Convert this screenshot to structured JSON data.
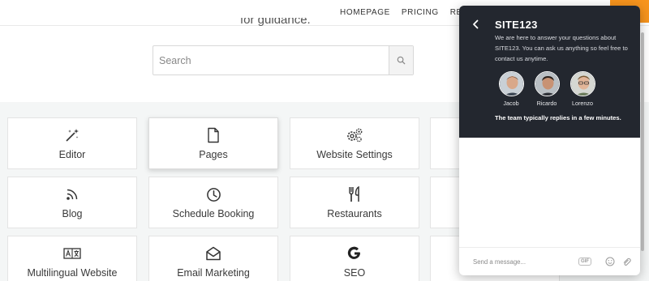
{
  "nav": {
    "links": [
      "HOMEPAGE",
      "PRICING",
      "REVIEWS"
    ],
    "cta_color": "#f7941d"
  },
  "headline": "for guidance.",
  "search": {
    "placeholder": "Search",
    "button_icon": "search-icon"
  },
  "cards": [
    {
      "label": "Editor",
      "icon": "magic-wand-icon"
    },
    {
      "label": "Pages",
      "icon": "page-icon",
      "active": true
    },
    {
      "label": "Website Settings",
      "icon": "gears-icon"
    },
    {
      "label": "Blog",
      "icon": "rss-icon"
    },
    {
      "label": "Schedule Booking",
      "icon": "clock-icon"
    },
    {
      "label": "Restaurants",
      "icon": "fork-knife-icon"
    },
    {
      "label": "Multilingual Website",
      "icon": "translate-icon"
    },
    {
      "label": "Email Marketing",
      "icon": "envelope-open-icon"
    },
    {
      "label": "SEO",
      "icon": "google-g-icon"
    }
  ],
  "chat": {
    "title": "SITE123",
    "description": "We are here to answer your questions about SITE123. You can ask us anything so feel free to contact us anytime.",
    "agents": [
      {
        "name": "Jacob"
      },
      {
        "name": "Ricardo"
      },
      {
        "name": "Lorenzo"
      }
    ],
    "reply_time": "The team typically replies in a few minutes.",
    "input_placeholder": "Send a message...",
    "gif_label": "GIF",
    "header_color": "#23272f"
  }
}
